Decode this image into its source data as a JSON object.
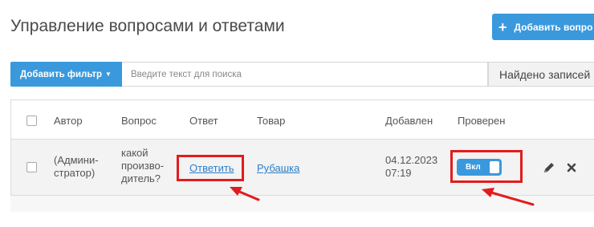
{
  "header": {
    "title": "Управление вопросами и ответами",
    "add_button_label": "Добавить вопро"
  },
  "filter": {
    "button_label": "Добавить фильтр",
    "search_placeholder": "Введите текст для поиска",
    "search_value": "",
    "found_text": "Найдено записей"
  },
  "table": {
    "columns": [
      "Автор",
      "Вопрос",
      "Ответ",
      "Товар",
      "Добавлен",
      "Проверен"
    ],
    "rows": [
      {
        "author_line1": "(Админи-",
        "author_line2": "стратор)",
        "question_line1": "какой",
        "question_line2": "произво-",
        "question_line3": "дитель?",
        "answer_link": "Ответить",
        "product_link": "Рубашка",
        "date": "04.12.2023",
        "time": "07:19",
        "verified_label": "Вкл",
        "verified": true
      }
    ]
  },
  "icons": {
    "add": "plus-icon",
    "filter_caret": "caret-down-icon",
    "edit": "pencil-icon",
    "delete": "close-icon"
  },
  "colors": {
    "accent": "#3a99dd",
    "link": "#2a7fc9",
    "highlight": "#e21c1c",
    "row_background": "#f3f3f3"
  }
}
